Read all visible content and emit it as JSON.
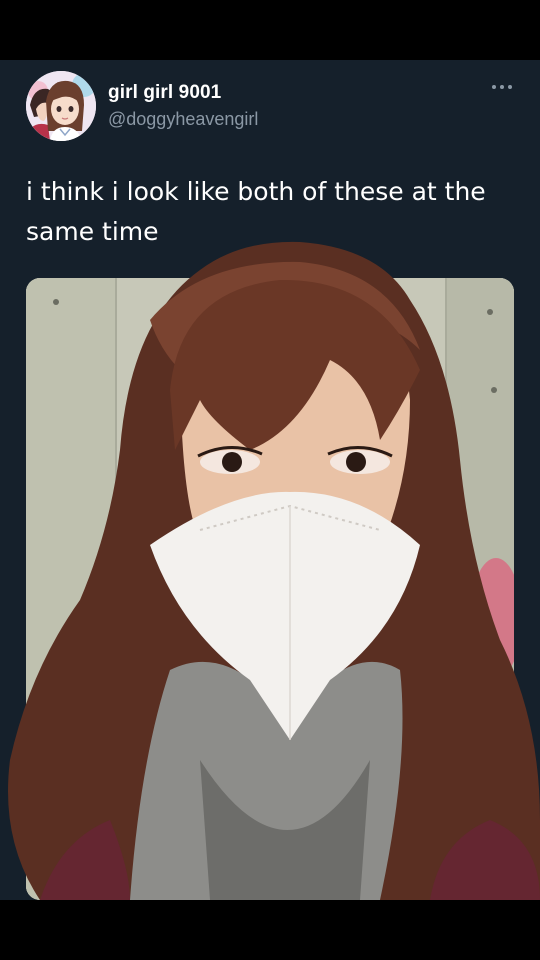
{
  "tweet": {
    "display_name": "girl girl 9001",
    "handle": "@doggyheavengirl",
    "text_line1": "i think i look like both of these at the",
    "text_line2": "same time"
  },
  "icons": {
    "more": "more-horizontal-icon",
    "avatar": "anime-avatar"
  },
  "colors": {
    "background": "#15202b",
    "name": "#ffffff",
    "handle": "#8b98a5",
    "text": "#ffffff"
  }
}
